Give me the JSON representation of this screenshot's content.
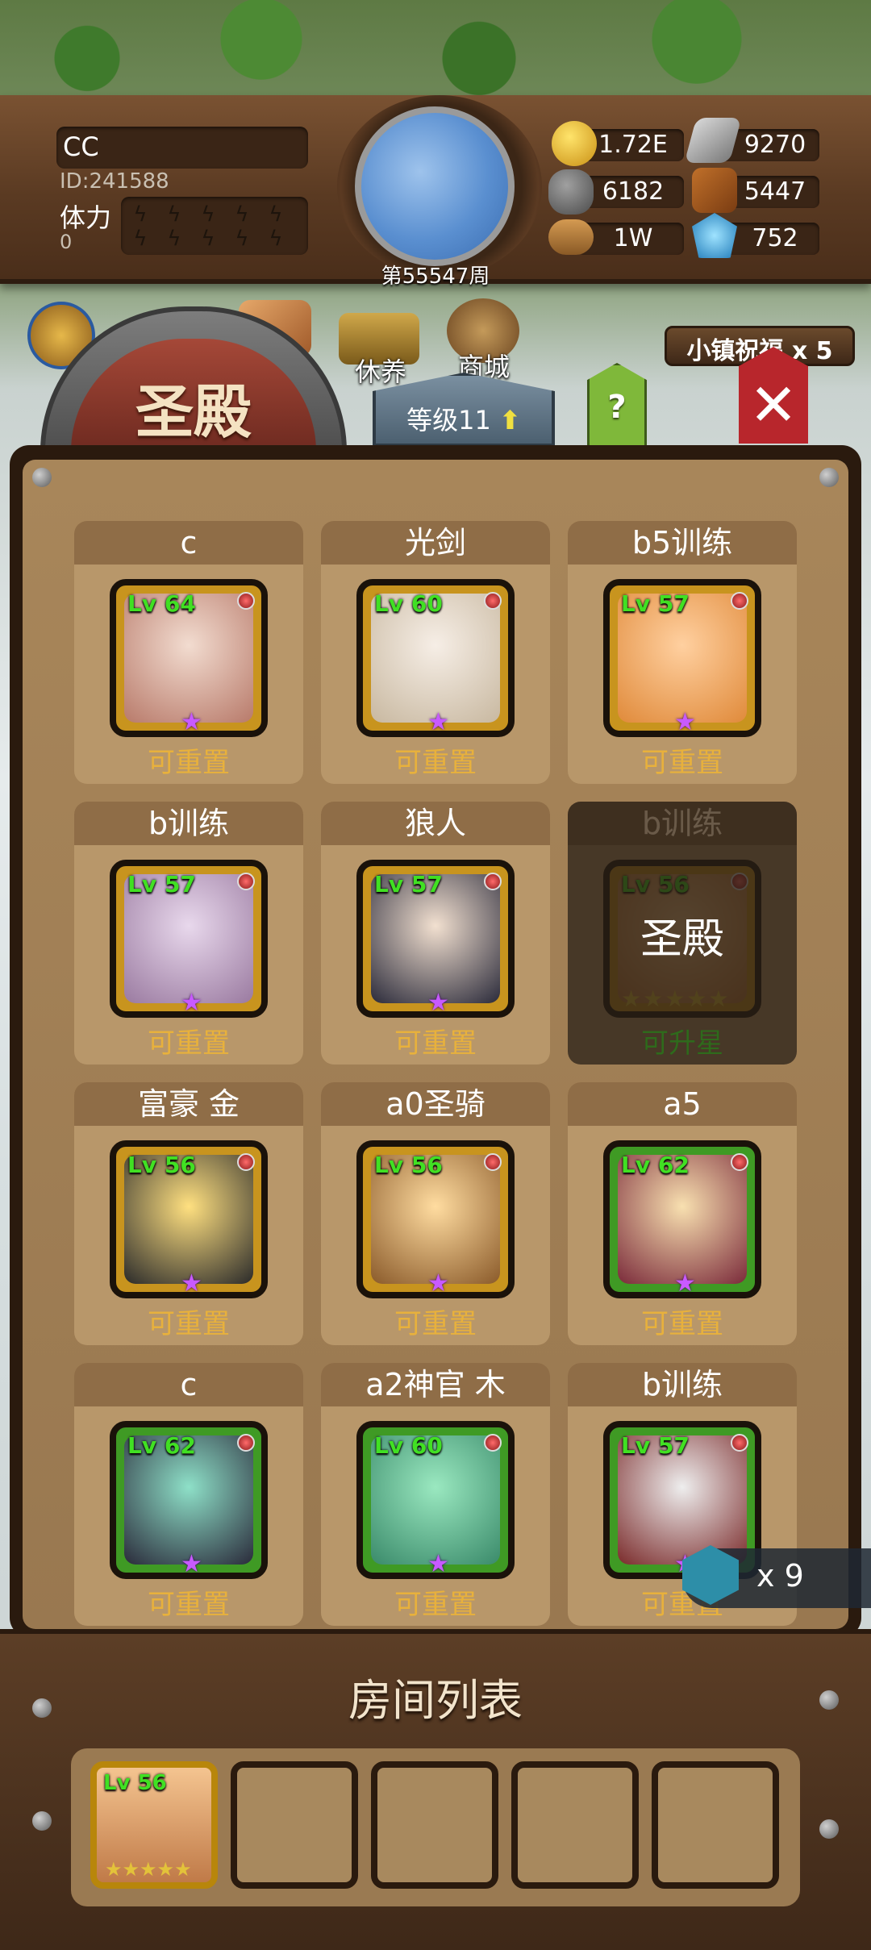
{
  "player": {
    "name": "CC",
    "id": "ID:241588",
    "stamina_label": "体力",
    "stamina_value": "0"
  },
  "week": "第55547周",
  "resources": [
    {
      "icon": "gold-coin-icon",
      "value": "1.72E"
    },
    {
      "icon": "iron-ingot-icon",
      "value": "9270"
    },
    {
      "icon": "stone-icon",
      "value": "6182"
    },
    {
      "icon": "leather-icon",
      "value": "5447"
    },
    {
      "icon": "wood-log-icon",
      "value": "1W"
    },
    {
      "icon": "crystal-icon",
      "value": "752"
    }
  ],
  "nav": {
    "rest": "休养",
    "shop": "商城"
  },
  "tabs": {
    "title": "圣殿",
    "level": "等级11",
    "help": "?"
  },
  "blessing": "小镇祝福 x 5",
  "heroes": [
    {
      "name": "c",
      "lv": "Lv 64",
      "status": "可重置"
    },
    {
      "name": "光剑",
      "lv": "Lv 60",
      "status": "可重置"
    },
    {
      "name": "b5训练",
      "lv": "Lv 57",
      "status": "可重置"
    },
    {
      "name": "b训练",
      "lv": "Lv 57",
      "status": "可重置"
    },
    {
      "name": "狼人",
      "lv": "Lv 57",
      "status": "可重置"
    },
    {
      "name": "b训练",
      "lv": "Lv 56",
      "status": "可升星",
      "overlay": "圣殿"
    },
    {
      "name": "富豪 金",
      "lv": "Lv 56",
      "status": "可重置"
    },
    {
      "name": "a0圣骑",
      "lv": "Lv 56",
      "status": "可重置"
    },
    {
      "name": "a5",
      "lv": "Lv 62",
      "status": "可重置"
    },
    {
      "name": "c",
      "lv": "Lv 62",
      "status": "可重置"
    },
    {
      "name": "a2神官 木",
      "lv": "Lv 60",
      "status": "可重置"
    },
    {
      "name": "b训练",
      "lv": "Lv 57",
      "status": "可重置"
    }
  ],
  "token": {
    "count": "x 9"
  },
  "room": {
    "title": "房间列表",
    "slot1_lv": "Lv 56"
  },
  "colors": {
    "reset": "#e8b13c",
    "upgrade": "#3a8a22",
    "level": "#41e023"
  }
}
